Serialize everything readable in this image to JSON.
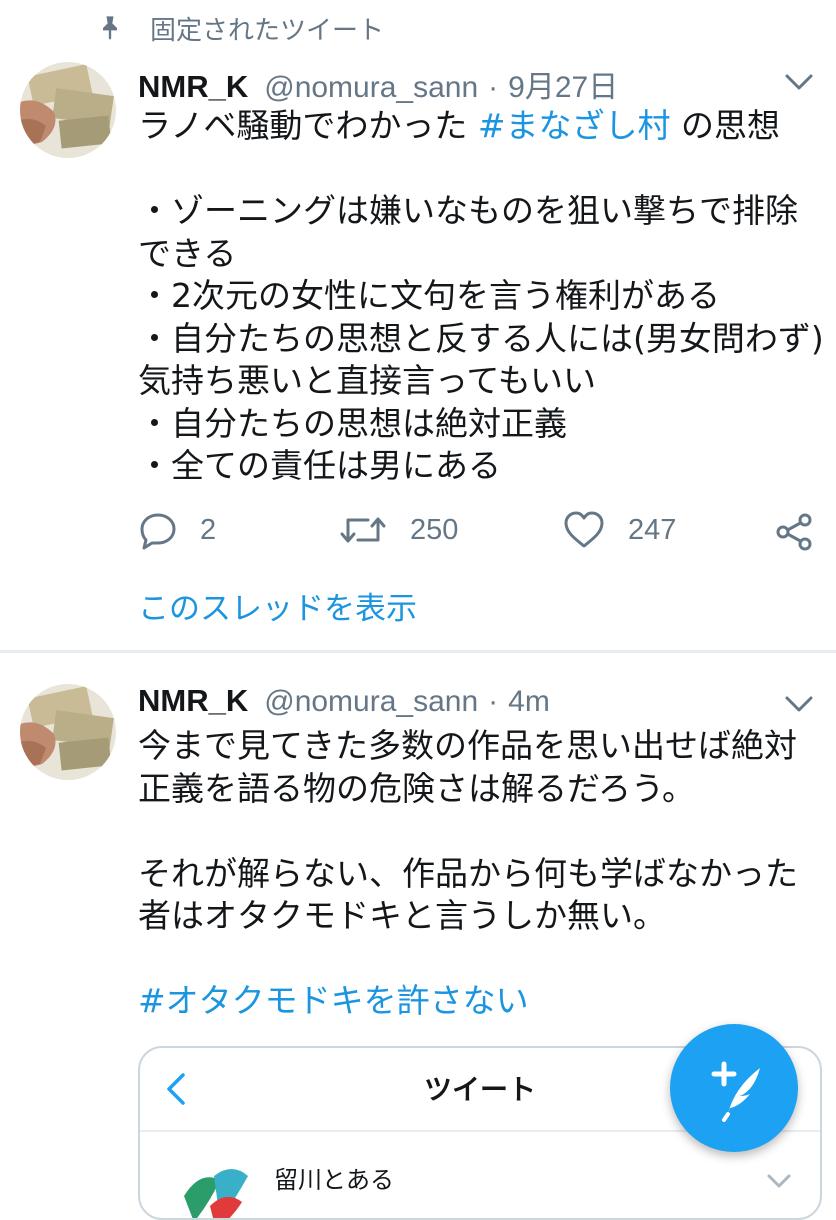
{
  "pinned": {
    "label": "固定されたツイート"
  },
  "tweet1": {
    "name": "NMR_K",
    "handle": "@nomura_sann",
    "separator": "·",
    "time": "9月27日",
    "lines": [
      {
        "pre": "ラノベ騒動でわかった ",
        "tag": "#まなざし村",
        "post": " の思想"
      },
      {
        "pre": ""
      },
      {
        "pre": "・ゾーニングは嫌いなものを狙い撃ちで排除"
      },
      {
        "pre": "できる"
      },
      {
        "pre": "・2次元の女性に文句を言う権利がある"
      },
      {
        "pre": "・自分たちの思想と反する人には(男女問わず)"
      },
      {
        "pre": "気持ち悪いと直接言ってもいい"
      },
      {
        "pre": "・自分たちの思想は絶対正義"
      },
      {
        "pre": "・全ての責任は男にある"
      }
    ],
    "replies": "2",
    "retweets": "250",
    "likes": "247",
    "thread_link": "このスレッドを表示"
  },
  "tweet2": {
    "name": "NMR_K",
    "handle": "@nomura_sann",
    "separator": "·",
    "time": "4m",
    "lines": [
      {
        "pre": "今まで見てきた多数の作品を思い出せば絶対"
      },
      {
        "pre": "正義を語る物の危険さは解るだろう。"
      },
      {
        "pre": ""
      },
      {
        "pre": "それが解らない、作品から何も学ばなかった"
      },
      {
        "pre": "者はオタクモドキと言うしか無い。"
      },
      {
        "pre": ""
      },
      {
        "pre": "",
        "tag": "#オタクモドキを許さない"
      }
    ]
  },
  "embed": {
    "title": "ツイート",
    "user_name": "留川とある"
  },
  "colors": {
    "accent": "#1da1f2",
    "link": "#1b95e0",
    "muted": "#657786",
    "divider": "#e6ecf0"
  },
  "icons": [
    "pin-icon",
    "chevron-down-icon",
    "reply-icon",
    "retweet-icon",
    "like-icon",
    "share-icon",
    "back-icon",
    "compose-icon"
  ]
}
